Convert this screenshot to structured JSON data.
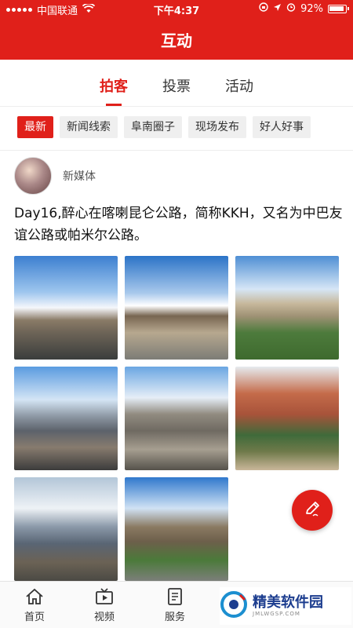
{
  "status_bar": {
    "carrier": "中国联通",
    "time": "下午4:37",
    "battery": "92%"
  },
  "header": {
    "title": "互动"
  },
  "tabs": [
    {
      "label": "拍客"
    },
    {
      "label": "投票"
    },
    {
      "label": "活动"
    }
  ],
  "chips": [
    {
      "label": "最新"
    },
    {
      "label": "新闻线索"
    },
    {
      "label": "阜南圈子"
    },
    {
      "label": "现场发布"
    },
    {
      "label": "好人好事"
    }
  ],
  "post": {
    "author": "新媒体",
    "text": "Day16,醉心在喀喇昆仑公路，简称KKH，又名为中巴友谊公路或帕米尔公路。",
    "photo_count": 8
  },
  "bottom_nav": [
    {
      "label": "首页",
      "icon": "home-icon"
    },
    {
      "label": "视频",
      "icon": "video-icon"
    },
    {
      "label": "服务",
      "icon": "service-icon"
    }
  ],
  "watermark": {
    "text": "精美软件园",
    "sub": "JMLWGSP.COM"
  },
  "colors": {
    "accent": "#e0201a",
    "chip_bg": "#efefef"
  }
}
